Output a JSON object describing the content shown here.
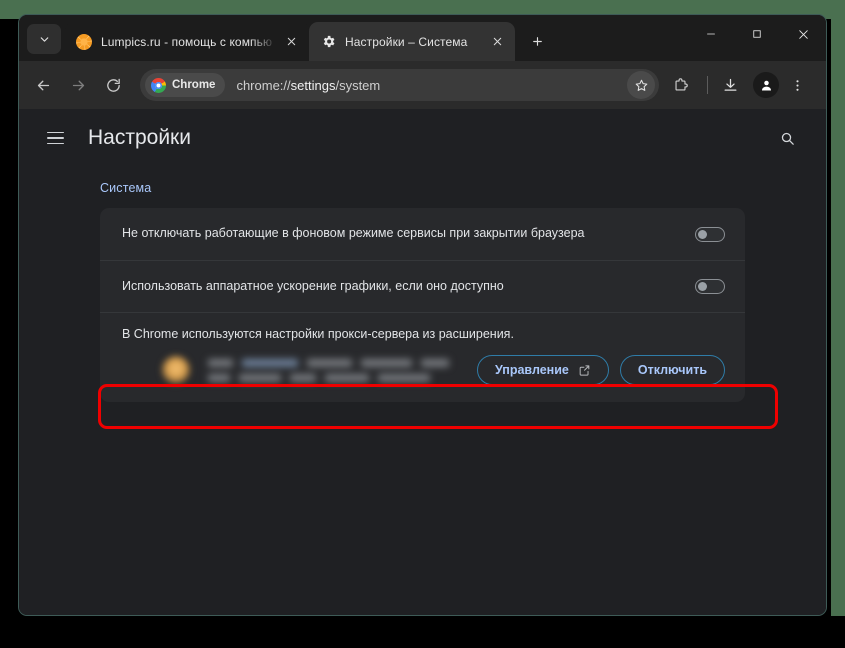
{
  "window": {
    "controls": {
      "minimize": "minimize-icon",
      "maximize": "maximize-icon",
      "close": "close-icon"
    },
    "tab_search": "tab-search-chevron-icon"
  },
  "tabs": [
    {
      "title": "Lumpics.ru - помощь с компью",
      "favicon": "orange-slice-favicon",
      "active": false
    },
    {
      "title": "Настройки – Система",
      "favicon": "gear-icon",
      "active": true
    }
  ],
  "new_tab": {
    "label": "+",
    "name": "new-tab-button"
  },
  "toolbar": {
    "back": "back-arrow-icon",
    "forward": "forward-arrow-icon",
    "reload": "reload-icon",
    "chip_label": "Chrome",
    "url_prefix": "chrome://",
    "url_strong": "settings",
    "url_suffix": "/system",
    "url_full": "chrome://settings/system",
    "star": "bookmark-star-icon",
    "extensions": "extensions-puzzle-icon",
    "downloads": "downloads-icon",
    "profile": "profile-avatar-icon",
    "menu": "three-dot-menu-icon"
  },
  "settings": {
    "menu_button": "hamburger-menu-icon",
    "title": "Настройки",
    "search": "search-icon",
    "section_heading": "Система",
    "rows": [
      {
        "label": "Не отключать работающие в фоновом режиме сервисы при закрытии браузера",
        "toggle_state": "off"
      },
      {
        "label": "Использовать аппаратное ускорение графики, если оно доступно",
        "toggle_state": "off",
        "highlighted": true
      }
    ],
    "proxy": {
      "note": "В Chrome используются настройки прокси-сервера из расширения.",
      "extension_name_redacted": true,
      "manage_button": "Управление",
      "manage_icon": "external-link-icon",
      "disable_button": "Отключить"
    }
  },
  "colors": {
    "annotation_red": "#ef0000",
    "accent_blue": "#a9c7fa",
    "button_border": "#2f7ca8",
    "page_bg": "#1f2023",
    "card_bg": "#28292c",
    "toolbar_bg": "#2b2b2b",
    "tabstrip_bg": "#1c1c1c",
    "active_tab_bg": "#333333",
    "outer_backdrop": "#4a7050"
  }
}
